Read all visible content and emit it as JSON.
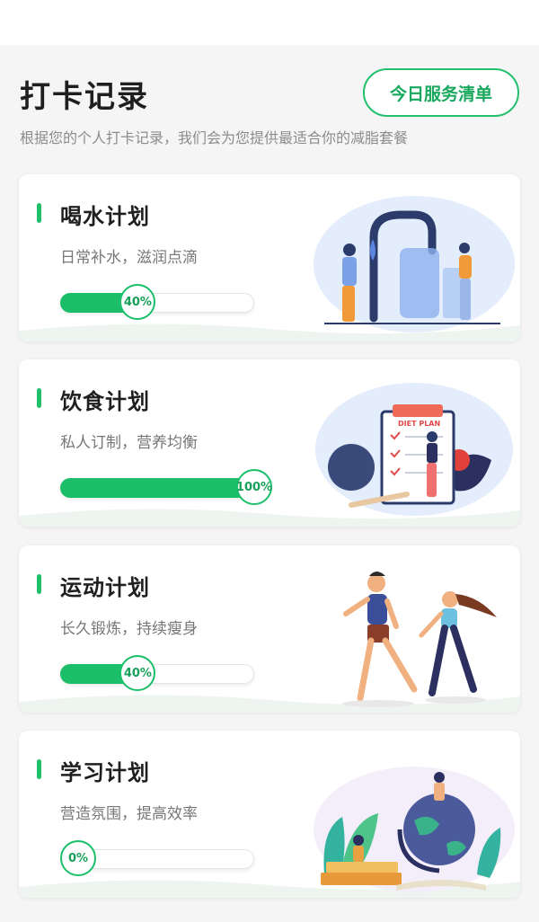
{
  "header": {
    "title": "打卡记录",
    "service_button": "今日服务清单",
    "subtitle": "根据您的个人打卡记录，我们会为您提供最适合你的减脂套餐"
  },
  "plans": [
    {
      "title": "喝水计划",
      "desc": "日常补水，滋润点滴",
      "progress": 40,
      "progress_label": "40%",
      "illustration": "water-dispenser-illustration"
    },
    {
      "title": "饮食计划",
      "desc": "私人订制，营养均衡",
      "progress": 100,
      "progress_label": "100%",
      "illustration": "diet-plan-illustration",
      "illustration_text": "DIET PLAN"
    },
    {
      "title": "运动计划",
      "desc": "长久锻炼，持续瘦身",
      "progress": 40,
      "progress_label": "40%",
      "illustration": "running-people-illustration"
    },
    {
      "title": "学习计划",
      "desc": "营造氛围，提高效率",
      "progress": 0,
      "progress_label": "0%",
      "illustration": "study-globe-illustration"
    }
  ],
  "colors": {
    "accent": "#1bbf6a",
    "card_bg": "#ffffff",
    "page_bg": "#f5f5f5"
  }
}
